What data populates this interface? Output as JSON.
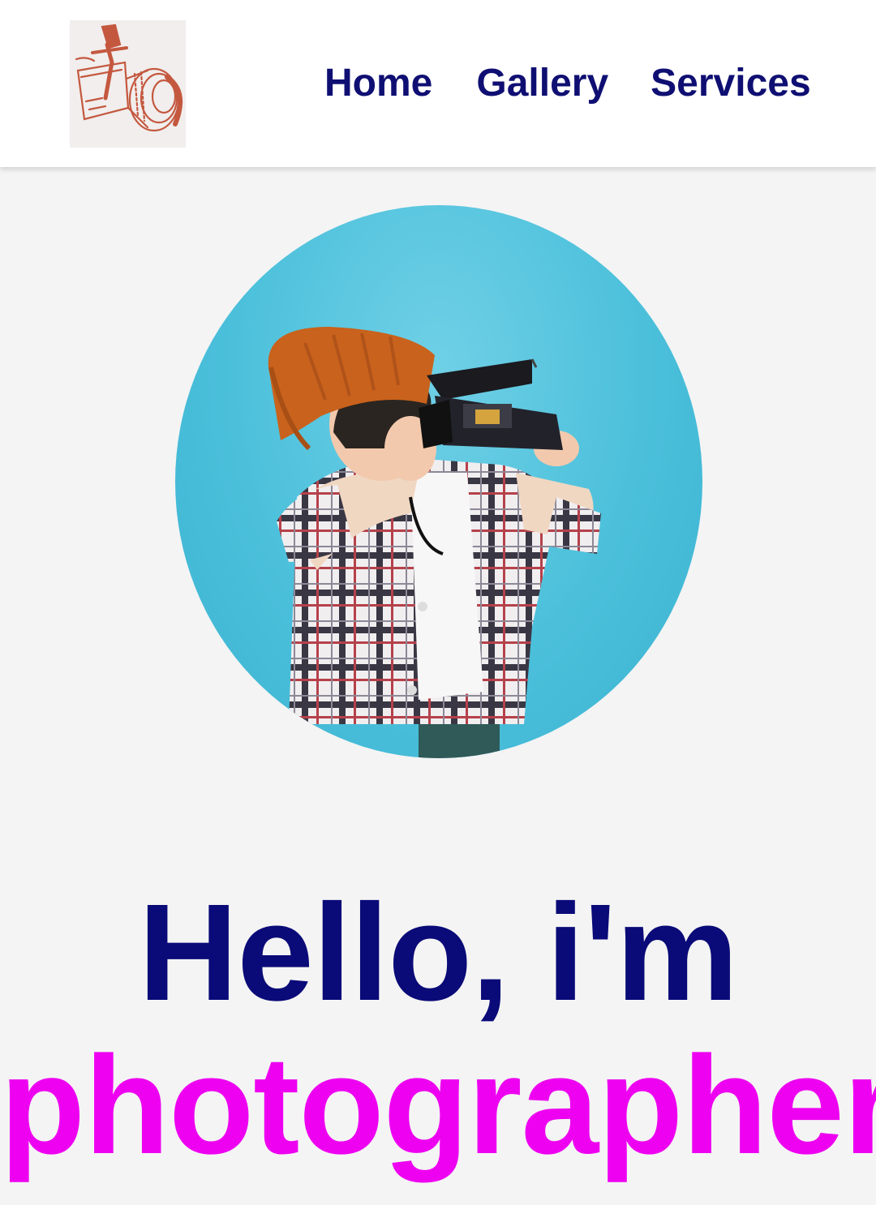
{
  "header": {
    "logo_icon": "camera-sketch-icon",
    "nav": {
      "home": "Home",
      "gallery": "Gallery",
      "services": "Services"
    }
  },
  "hero": {
    "photo_subject": "child-with-camera-photo",
    "greeting": "Hello, i'm",
    "role": "photographer"
  },
  "colors": {
    "nav_text": "#0f0f73",
    "greeting": "#0a0a78",
    "role": "#ee00f0",
    "logo_sketch": "#c4583f",
    "photo_background": "#4cc0db",
    "page_background": "#f4f4f4"
  }
}
